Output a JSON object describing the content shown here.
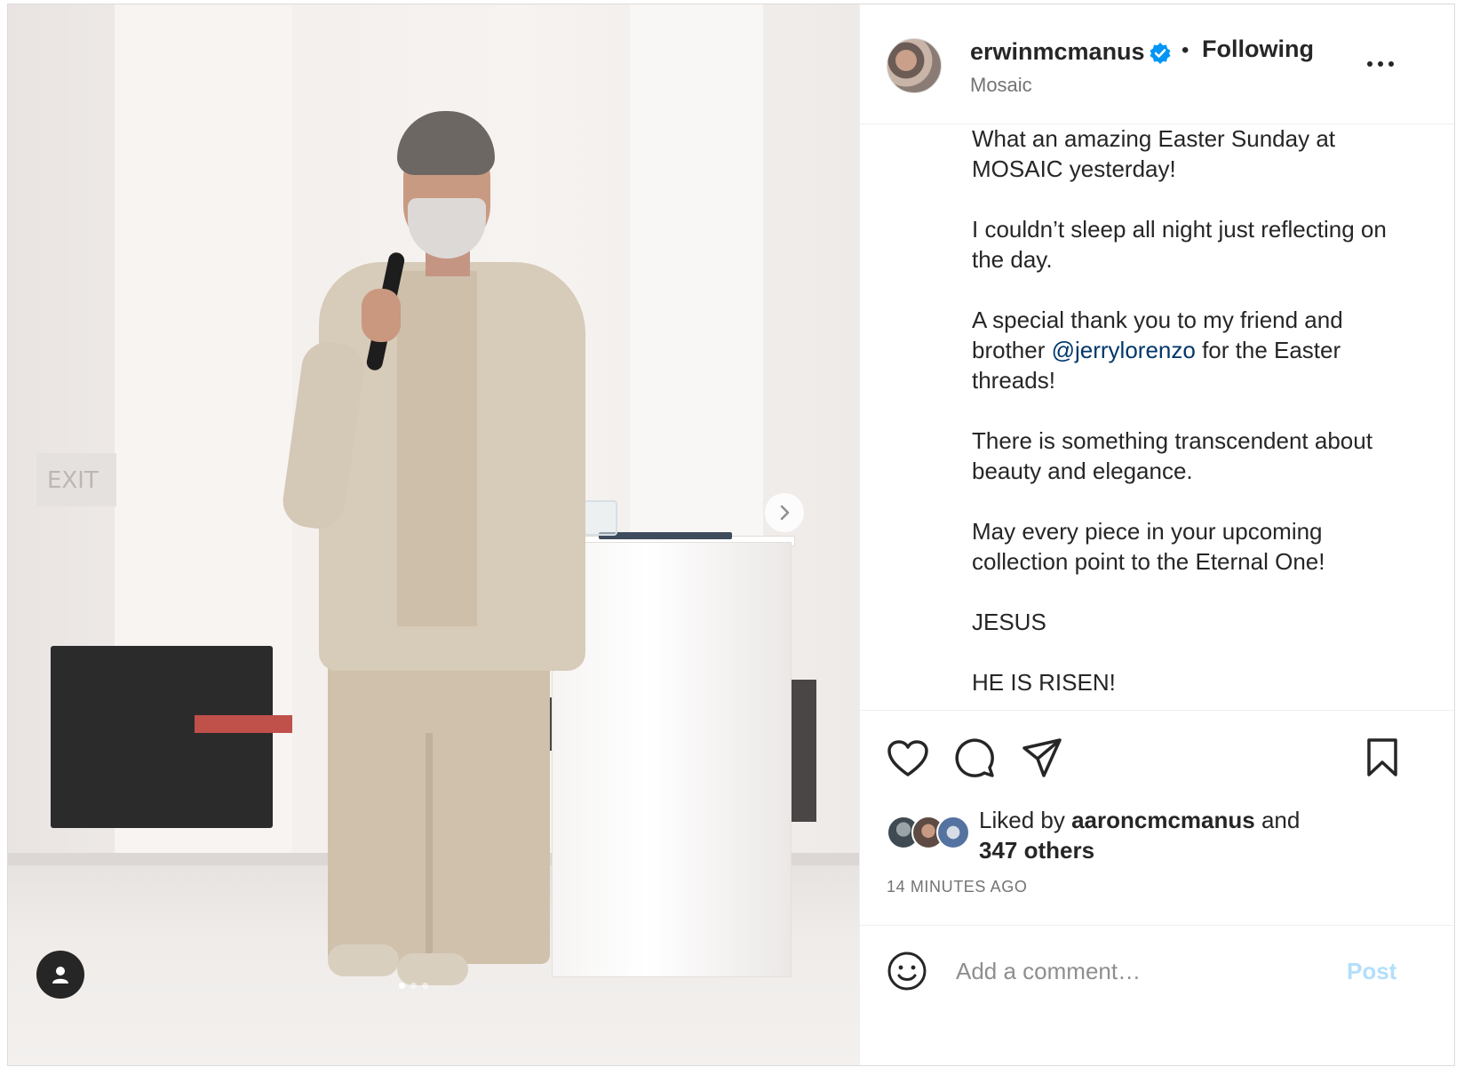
{
  "post": {
    "username": "erwinmcmanus",
    "verified": true,
    "separator": "•",
    "follow_status": "Following",
    "location": "Mosaic",
    "more_icon": "more-horizontal-icon"
  },
  "media": {
    "exit_sign": "EXIT",
    "slide_count": 3,
    "active_slide": 1,
    "next_icon": "chevron-right-icon",
    "tag_icon": "user-tag-icon"
  },
  "caption": {
    "line1": "What an amazing Easter Sunday at MOSAIC yesterday!",
    "line2": "I couldn’t sleep all night just reflecting on the day.",
    "line3_before": "A special thank you to my friend and brother ",
    "mention": "@jerrylorenzo",
    "line3_after": " for the Easter threads!",
    "line4": "There is something transcendent about beauty and elegance.",
    "line5": "May every piece in your upcoming collection point to the Eternal One!",
    "line6": "JESUS",
    "line7": "HE IS RISEN!"
  },
  "actions": {
    "like_icon": "heart-icon",
    "comment_icon": "comment-icon",
    "share_icon": "send-icon",
    "save_icon": "bookmark-icon"
  },
  "likes": {
    "prefix": "Liked by ",
    "first_liker": "aaroncmcmanus",
    "connector": " and",
    "others": "347 others"
  },
  "timestamp": "14 MINUTES AGO",
  "comment": {
    "emoji_icon": "emoji-icon",
    "placeholder": "Add a comment…",
    "post_label": "Post"
  },
  "colors": {
    "verified_blue": "#0095f6",
    "mention_blue": "#00376b",
    "post_disabled": "#b2dffc",
    "text_primary": "#262626",
    "text_secondary": "#737373"
  }
}
